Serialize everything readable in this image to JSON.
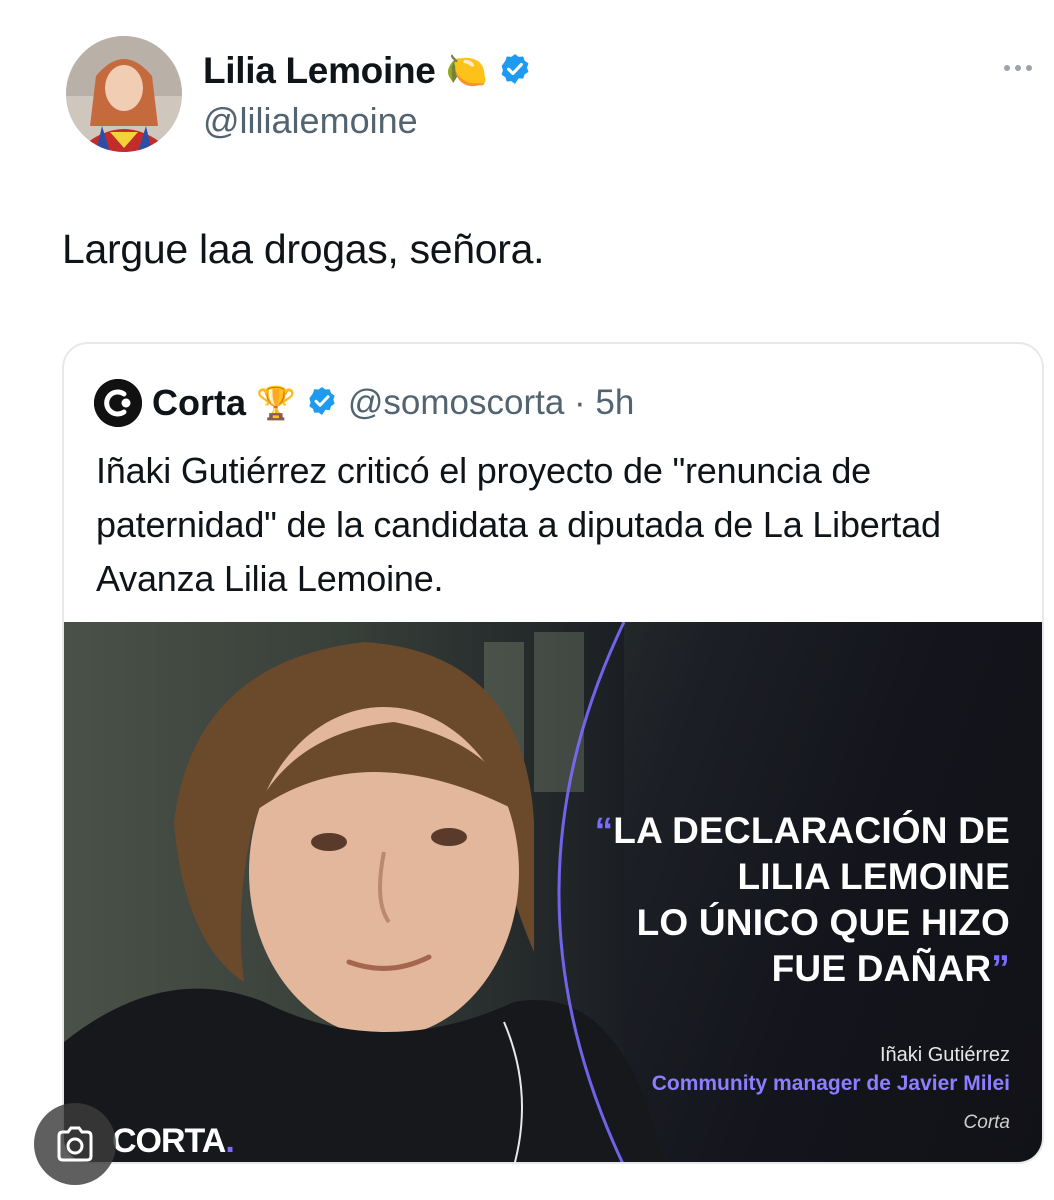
{
  "tweet": {
    "author_name": "Lilia Lemoine",
    "author_emoji": "🍋",
    "verified_icon": "verified-badge-icon",
    "author_handle": "@lilialemoine",
    "text": "Largue laa drogas, señora."
  },
  "quoted": {
    "author_name": "Corta",
    "author_emoji": "🏆",
    "author_handle": "@somoscorta · 5h",
    "text": "Iñaki Gutiérrez criticó el proyecto de \"renuncia de paternidad\" de la candidata a diputada de La Libertad Avanza Lilia Lemoine.",
    "media": {
      "quote_open": "“",
      "quote_lines": [
        "LA DECLARACIÓN DE",
        "LILIA LEMOINE",
        "LO ÚNICO QUE HIZO",
        "FUE DAÑAR"
      ],
      "quote_close": "”",
      "caption_name": "Iñaki Gutiérrez",
      "caption_role": "Community manager de Javier Milei",
      "caption_source": "Corta",
      "brand_text": "CORTA",
      "brand_dot": ".",
      "accent_color": "#7b6cff"
    }
  },
  "colors": {
    "text": "#0f1419",
    "secondary": "#536471",
    "verified": "#1d9bf0",
    "border": "#e6e9ec"
  }
}
